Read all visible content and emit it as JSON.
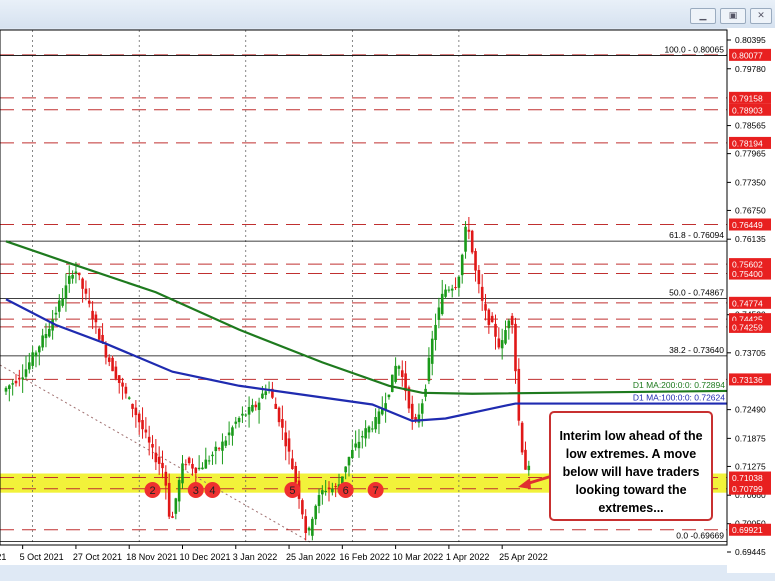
{
  "window": {
    "minimize_icon": "minimize-icon",
    "restore_icon": "restore-icon",
    "close_icon": "close-icon"
  },
  "chart_data": {
    "type": "candlestick",
    "title": "",
    "ylim": [
      0.69445,
      0.80395
    ],
    "y_ticks": [
      "0.80395",
      "0.79780",
      "0.78565",
      "0.77965",
      "0.77350",
      "0.76750",
      "0.76135",
      "0.74520",
      "0.73705",
      "0.72490",
      "0.71875",
      "0.71275",
      "0.70660",
      "0.70050",
      "0.69445"
    ],
    "x_ticks": [
      {
        "label": "21",
        "day": -2
      },
      {
        "label": "5 Oct 2021",
        "day": 5
      },
      {
        "label": "27 Oct 2021",
        "day": 21
      },
      {
        "label": "18 Nov 2021",
        "day": 37
      },
      {
        "label": "10 Dec 2021",
        "day": 53
      },
      {
        "label": "3 Jan 2022",
        "day": 69
      },
      {
        "label": "25 Jan 2022",
        "day": 85
      },
      {
        "label": "16 Feb 2022",
        "day": 101
      },
      {
        "label": "10 Mar 2022",
        "day": 117
      },
      {
        "label": "1 Apr 2022",
        "day": 133
      },
      {
        "label": "25 Apr 2022",
        "day": 149
      }
    ],
    "price_path": [
      [
        0,
        0.7291
      ],
      [
        6,
        0.733
      ],
      [
        13,
        0.7419
      ],
      [
        18,
        0.75
      ],
      [
        21,
        0.7556
      ],
      [
        25,
        0.748
      ],
      [
        30,
        0.7377
      ],
      [
        35,
        0.73
      ],
      [
        39,
        0.7248
      ],
      [
        45,
        0.715
      ],
      [
        48,
        0.712
      ],
      [
        50,
        0.6996
      ],
      [
        52,
        0.708
      ],
      [
        54,
        0.7141
      ],
      [
        58,
        0.712
      ],
      [
        61,
        0.7141
      ],
      [
        66,
        0.718
      ],
      [
        70,
        0.7227
      ],
      [
        76,
        0.726
      ],
      [
        79,
        0.7302
      ],
      [
        83,
        0.722
      ],
      [
        86,
        0.7141
      ],
      [
        89,
        0.705
      ],
      [
        91,
        0.697
      ],
      [
        93,
        0.704
      ],
      [
        96,
        0.708
      ],
      [
        100,
        0.708
      ],
      [
        103,
        0.7141
      ],
      [
        108,
        0.72
      ],
      [
        112,
        0.7227
      ],
      [
        116,
        0.73
      ],
      [
        118,
        0.7355
      ],
      [
        121,
        0.728
      ],
      [
        123,
        0.7205
      ],
      [
        126,
        0.728
      ],
      [
        129,
        0.742
      ],
      [
        132,
        0.7505
      ],
      [
        136,
        0.752
      ],
      [
        138,
        0.76
      ],
      [
        139,
        0.7662
      ],
      [
        141,
        0.756
      ],
      [
        144,
        0.746
      ],
      [
        147,
        0.742
      ],
      [
        149,
        0.7377
      ],
      [
        152,
        0.746
      ],
      [
        153,
        0.742
      ],
      [
        154,
        0.725
      ],
      [
        155,
        0.72
      ],
      [
        156,
        0.713
      ],
      [
        157,
        0.712
      ]
    ],
    "series": [
      {
        "name": "D1 MA:200:0:0: 0.72894",
        "color": "#1e7a1e",
        "points": [
          [
            0,
            0.7609
          ],
          [
            20,
            0.756
          ],
          [
            45,
            0.75
          ],
          [
            70,
            0.742
          ],
          [
            95,
            0.735
          ],
          [
            115,
            0.73
          ],
          [
            125,
            0.7285
          ],
          [
            140,
            0.7283
          ],
          [
            160,
            0.7289
          ]
        ]
      },
      {
        "name": "D1 MA:100:0:0: 0.72624",
        "color": "#1f2bb0",
        "points": [
          [
            0,
            0.7485
          ],
          [
            15,
            0.743
          ],
          [
            30,
            0.739
          ],
          [
            50,
            0.733
          ],
          [
            70,
            0.73
          ],
          [
            90,
            0.728
          ],
          [
            110,
            0.726
          ],
          [
            122,
            0.7225
          ],
          [
            132,
            0.723
          ],
          [
            145,
            0.725
          ],
          [
            153,
            0.7262
          ],
          [
            160,
            0.7262
          ]
        ]
      }
    ],
    "fib_levels": [
      {
        "label": "100.0 - 0.80065",
        "value": 0.80065
      },
      {
        "label": "61.8 - 0.76094",
        "value": 0.76094
      },
      {
        "label": "50.0 - 0.74867",
        "value": 0.74867
      },
      {
        "label": "38.2 - 0.73640",
        "value": 0.7364
      },
      {
        "label": "0.0 -0.69669",
        "value": 0.69669
      }
    ],
    "red_levels": [
      "0.80077",
      "0.79158",
      "0.78903",
      "0.78194",
      "0.76449",
      "0.75602",
      "0.75400",
      "0.74774",
      "0.74425",
      "0.74259",
      "0.73136",
      "0.71038",
      "0.70799",
      "0.69921"
    ],
    "support_zone": [
      0.70799,
      0.71038
    ],
    "markers": [
      {
        "label": "2",
        "day": 44
      },
      {
        "label": "3",
        "day": 57
      },
      {
        "label": "4",
        "day": 62
      },
      {
        "label": "5",
        "day": 86
      },
      {
        "label": "6",
        "day": 102
      },
      {
        "label": "7",
        "day": 111
      }
    ],
    "annotation": "Interim low ahead of the low extremes.   A move below will have traders looking toward the extremes..."
  }
}
